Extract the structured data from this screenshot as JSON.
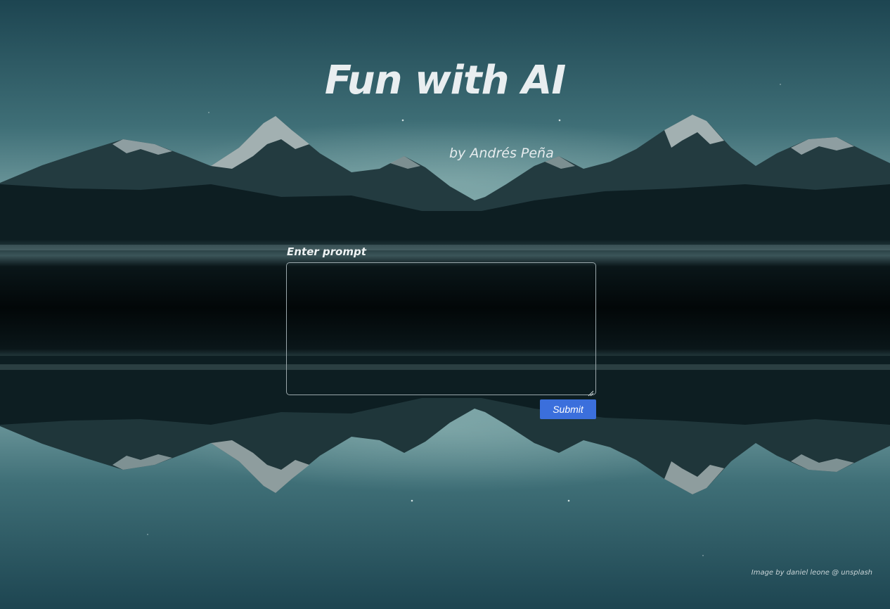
{
  "page": {
    "title": "Fun with AI",
    "byline": "by Andrés Peña"
  },
  "form": {
    "prompt_label": "Enter prompt",
    "prompt_value": "",
    "submit_label": "Submit"
  },
  "footer": {
    "credit": "Image by daniel leone @ unsplash"
  },
  "icons": {
    "resize": "resize-handle-icon"
  },
  "colors": {
    "submit_button": "#3b6fdc",
    "sky_top": "#1f4b57",
    "sky_horizon": "#6f9aa0",
    "water_dark": "#03090b"
  }
}
